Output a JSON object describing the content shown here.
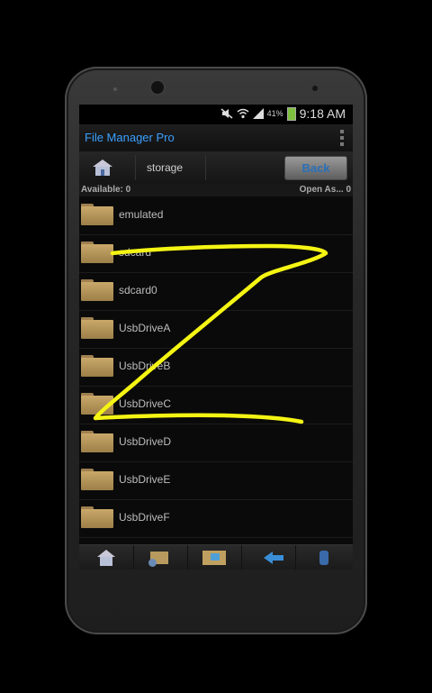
{
  "status_bar": {
    "battery_percent": "41%",
    "time": "9:18 AM",
    "icons": [
      "mute-icon",
      "wifi-icon",
      "signal-icon",
      "battery-icon"
    ]
  },
  "app": {
    "title": "File Manager Pro",
    "menu_icon": "overflow-menu-icon"
  },
  "path_bar": {
    "home_icon": "home-icon",
    "current": "storage",
    "back_label": "Back"
  },
  "info_bar": {
    "left": "Available: 0",
    "right": "Open As... 0"
  },
  "files": [
    {
      "name": "emulated"
    },
    {
      "name": "sdcard"
    },
    {
      "name": "sdcard0"
    },
    {
      "name": "UsbDriveA"
    },
    {
      "name": "UsbDriveB"
    },
    {
      "name": "UsbDriveC"
    },
    {
      "name": "UsbDriveD"
    },
    {
      "name": "UsbDriveE"
    },
    {
      "name": "UsbDriveF"
    }
  ],
  "bottom_toolbar": {
    "buttons": [
      "home-icon",
      "new-folder-icon",
      "move-icon",
      "back-arrow-icon",
      "more-icon"
    ]
  },
  "annotation": {
    "shape": "Z",
    "color": "#f5f514"
  }
}
